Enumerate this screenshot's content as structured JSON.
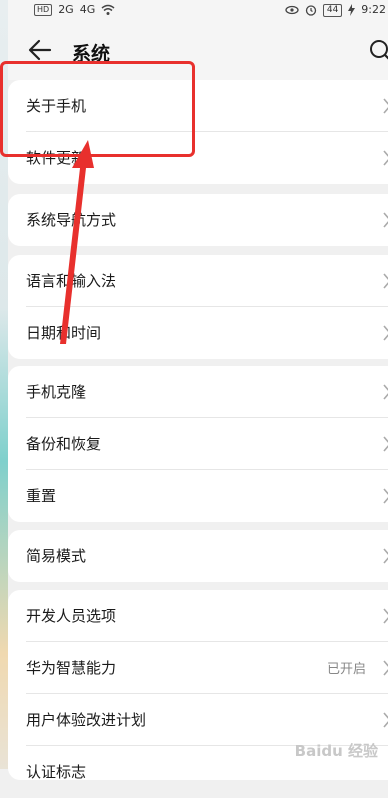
{
  "status_bar": {
    "left_icons": [
      "HD",
      "2G",
      "4G",
      "wifi-icon"
    ],
    "battery": "44",
    "time": "9:22"
  },
  "header": {
    "title": "系统"
  },
  "groups": [
    {
      "items": [
        {
          "label": "关于手机"
        },
        {
          "label": "软件更新"
        }
      ]
    },
    {
      "items": [
        {
          "label": "系统导航方式"
        }
      ]
    },
    {
      "items": [
        {
          "label": "语言和输入法"
        },
        {
          "label": "日期和时间"
        }
      ]
    },
    {
      "items": [
        {
          "label": "手机克隆"
        },
        {
          "label": "备份和恢复"
        },
        {
          "label": "重置"
        }
      ]
    },
    {
      "items": [
        {
          "label": "简易模式"
        }
      ]
    },
    {
      "items": [
        {
          "label": "开发人员选项"
        },
        {
          "label": "华为智慧能力",
          "value": "已开启"
        },
        {
          "label": "用户体验改进计划"
        },
        {
          "label": "认证标志"
        }
      ]
    }
  ],
  "watermark": "Baidu 经验",
  "colors": {
    "annotation": "#e8302d"
  }
}
